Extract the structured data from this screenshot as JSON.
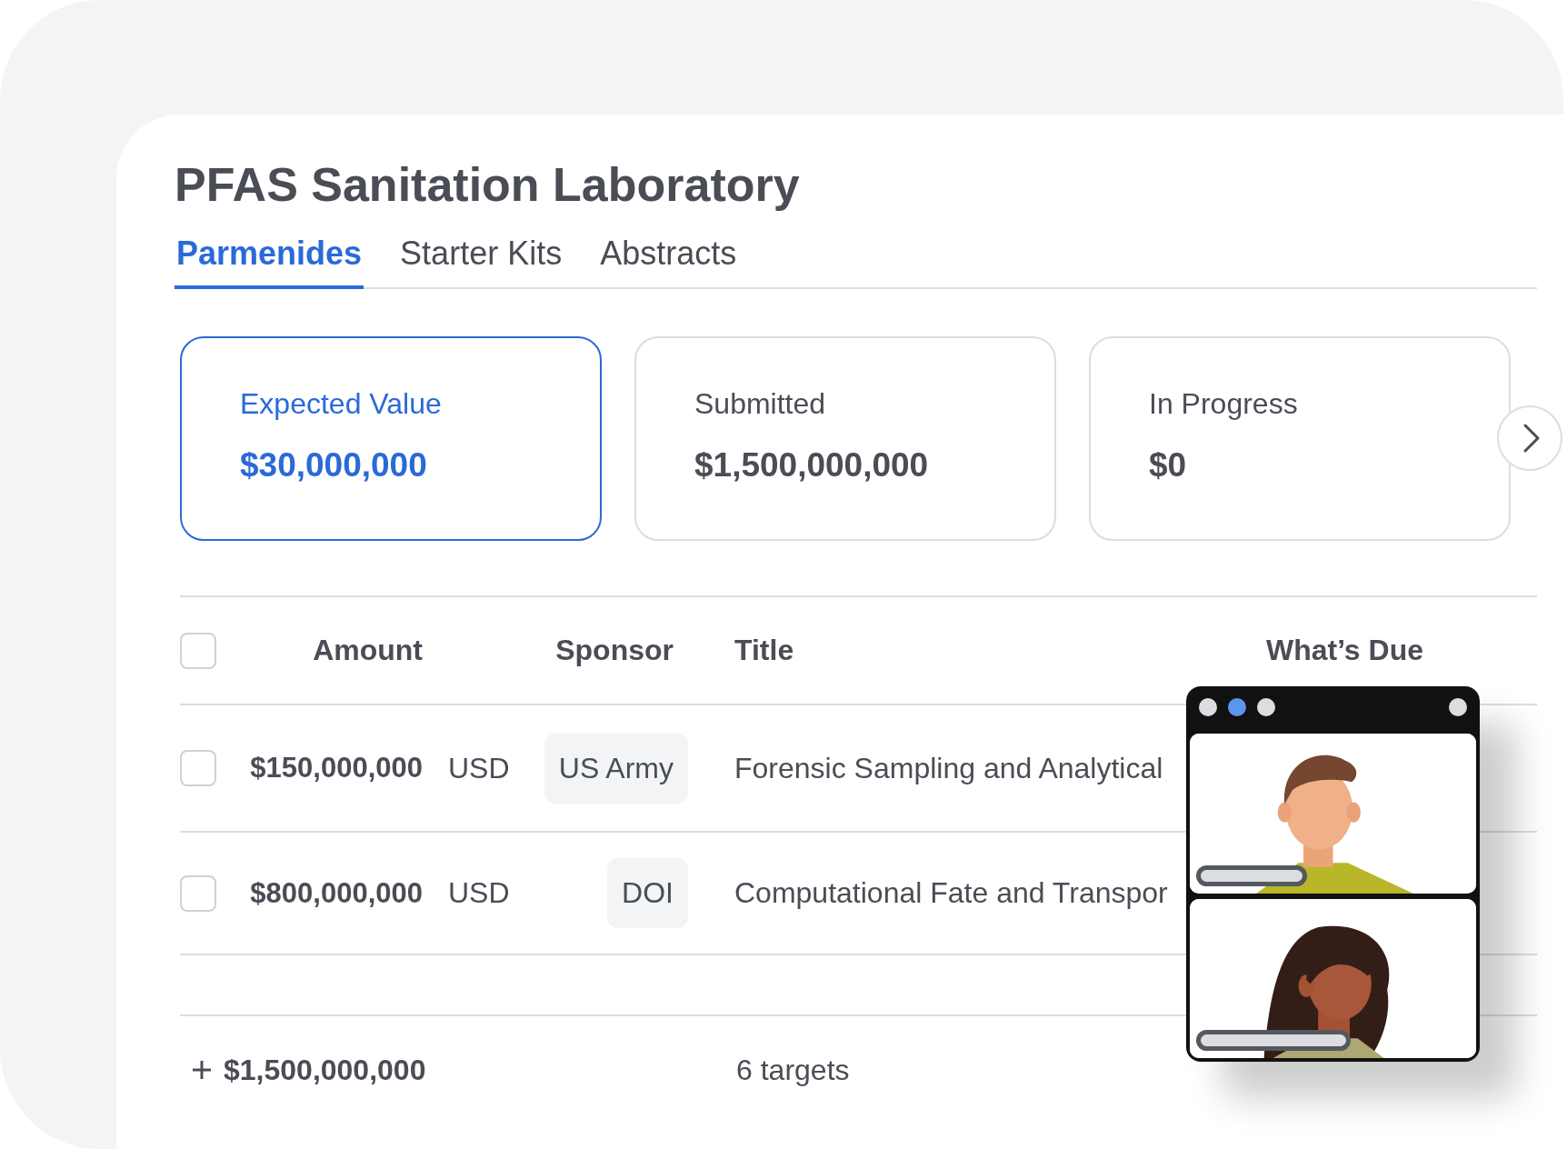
{
  "title": "PFAS Sanitation Laboratory",
  "tabs": [
    {
      "label": "Parmenides",
      "selected": true
    },
    {
      "label": "Starter Kits",
      "selected": false
    },
    {
      "label": "Abstracts",
      "selected": false
    }
  ],
  "cards": [
    {
      "label": "Expected Value",
      "value": "$30,000,000",
      "selected": true
    },
    {
      "label": "Submitted",
      "value": "$1,500,000,000",
      "selected": false
    },
    {
      "label": "In Progress",
      "value": "$0",
      "selected": false
    }
  ],
  "table": {
    "header_checked": false,
    "columns": [
      "Amount",
      "Sponsor",
      "Title",
      "What’s Due"
    ],
    "rows": [
      {
        "checked": false,
        "amount": "$150,000,000",
        "currency": "USD",
        "sponsor": "US Army",
        "title": "Forensic Sampling and Analytical"
      },
      {
        "checked": false,
        "amount": "$800,000,000",
        "currency": "USD",
        "sponsor": "DOI",
        "title": "Computational Fate and Transpor"
      }
    ]
  },
  "footer": {
    "total": "$1,500,000,000",
    "count": "6 targets"
  },
  "video_call": {
    "dots": [
      {
        "selected": false
      },
      {
        "selected": true
      },
      {
        "selected": false
      }
    ]
  }
}
